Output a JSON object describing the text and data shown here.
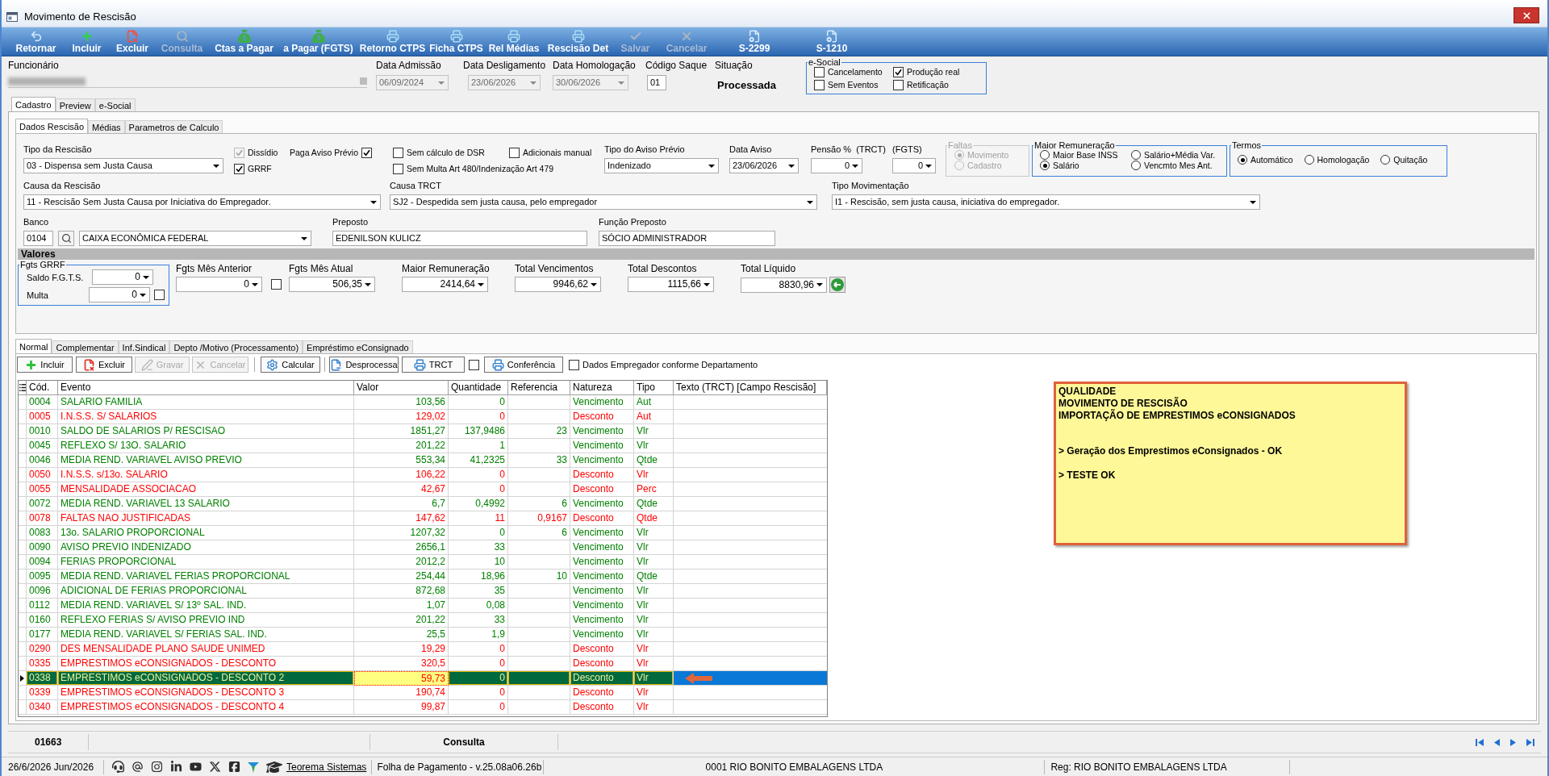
{
  "window": {
    "title": "Movimento de Rescisão"
  },
  "toolbar": [
    {
      "label": "Retornar",
      "disabled": false
    },
    {
      "label": "Incluir",
      "disabled": false
    },
    {
      "label": "Excluir",
      "disabled": false
    },
    {
      "label": "Consulta",
      "disabled": true
    },
    {
      "label": "Ctas a Pagar",
      "disabled": false
    },
    {
      "label": "a Pagar (FGTS)",
      "disabled": false
    },
    {
      "label": "Retorno CTPS",
      "disabled": false
    },
    {
      "label": "Ficha CTPS",
      "disabled": false
    },
    {
      "label": "Rel Médias",
      "disabled": false
    },
    {
      "label": "Rescisão Det",
      "disabled": false
    },
    {
      "label": "Salvar",
      "disabled": true
    },
    {
      "label": "Cancelar",
      "disabled": true
    },
    {
      "label": "S-2299",
      "disabled": false
    },
    {
      "label": "S-1210",
      "disabled": false
    }
  ],
  "header": {
    "employee": {
      "label": "Funcionário"
    },
    "dates": [
      {
        "label": "Data Admissão",
        "value": "06/09/2024",
        "disabled": true
      },
      {
        "label": "Data Desligamento",
        "value": "23/06/2026",
        "disabled": true
      },
      {
        "label": "Data Homologação",
        "value": "30/06/2026",
        "disabled": true
      }
    ],
    "codigo_saque": {
      "label": "Código Saque",
      "value": "01"
    },
    "situacao": {
      "label": "Situação",
      "value": "Processada"
    },
    "esocial": {
      "title": "e-Social",
      "options": [
        {
          "label": "Cancelamento",
          "checked": false
        },
        {
          "label": "Produção real",
          "checked": true
        },
        {
          "label": "Sem Eventos",
          "checked": false
        },
        {
          "label": "Retificação",
          "checked": false
        }
      ]
    }
  },
  "main_tabs": [
    {
      "label": "Cadastro",
      "selected": true
    },
    {
      "label": "Preview",
      "selected": false
    },
    {
      "label": "e-Social",
      "selected": false
    }
  ],
  "sub_tabs": [
    {
      "label": "Dados Rescisão",
      "selected": true
    },
    {
      "label": "Médias",
      "selected": false
    },
    {
      "label": "Parametros de Calculo",
      "selected": false
    }
  ],
  "dados_rescisao": {
    "tipo_rescisao": {
      "label": "Tipo da Rescisão",
      "value": "03 - Dispensa sem Justa Causa"
    },
    "dissidio": {
      "label": "Dissídio",
      "checked": true,
      "disabled": true
    },
    "grrf": {
      "label": "GRRF",
      "checked": true,
      "disabled": false
    },
    "paga_aviso_previo": {
      "label": "Paga Aviso Prévio",
      "checked": true
    },
    "sem_calculo_dsr": {
      "label": "Sem cálculo de DSR",
      "checked": false
    },
    "adicionais_manual": {
      "label": "Adicionais manual",
      "checked": false
    },
    "sem_multa": {
      "label": "Sem Multa Art 480/Indenização Art 479",
      "checked": false
    },
    "tipo_aviso_previo": {
      "label": "Tipo do Aviso Prévio",
      "value": "Indenizado"
    },
    "data_aviso": {
      "label": "Data Aviso",
      "value": "23/06/2026"
    },
    "pensao_trct": {
      "label": "Pensão %  (TRCT)",
      "value": "0"
    },
    "pensao_fgts": {
      "label": "(FGTS)",
      "value": "0"
    },
    "faltas": {
      "title": "Faltas",
      "disabled": true,
      "options": [
        {
          "label": "Movimento",
          "selected": true
        },
        {
          "label": "Cadastro",
          "selected": false
        }
      ]
    },
    "maior_remuneracao": {
      "title": "Maior Remuneração",
      "options": [
        {
          "label": "Maior Base INSS",
          "selected": false
        },
        {
          "label": "Salário+Média Var.",
          "selected": false
        },
        {
          "label": "Salário",
          "selected": true
        },
        {
          "label": "Vencmto Mes Ant.",
          "selected": false
        }
      ]
    },
    "termos": {
      "title": "Termos",
      "options": [
        {
          "label": "Automático",
          "selected": true
        },
        {
          "label": "Homologação",
          "selected": false
        },
        {
          "label": "Quitação",
          "selected": false
        }
      ]
    },
    "causa_rescisao": {
      "label": "Causa da Rescisão",
      "value": "11 - Rescisão Sem Justa Causa por Iniciativa do Empregador."
    },
    "causa_trct": {
      "label": "Causa TRCT",
      "value": "SJ2 - Despedida sem justa causa, pelo empregador"
    },
    "tipo_movimentacao": {
      "label": "Tipo Movimentação",
      "value": "I1 - Rescisão, sem justa causa, iniciativa do empregador."
    },
    "banco": {
      "label": "Banco",
      "code": "0104",
      "name": "CAIXA ECONÔMICA FEDERAL"
    },
    "preposto": {
      "label": "Preposto",
      "value": "EDENILSON KULICZ"
    },
    "funcao_preposto": {
      "label": "Função Preposto",
      "value": "SÓCIO ADMINISTRADOR"
    },
    "valores": {
      "title": "Valores",
      "fgts_grrf": {
        "title": "Fgts GRRF",
        "saldo": {
          "label": "Saldo F.G.T.S.",
          "value": "0"
        },
        "multa": {
          "label": "Multa",
          "value": "0",
          "checked": false
        }
      },
      "fgts_mes_anterior": {
        "label": "Fgts Mês Anterior",
        "value": "0",
        "checked": false
      },
      "totals": [
        {
          "label": "Fgts Mês Atual",
          "value": "506,35"
        },
        {
          "label": "Maior Remuneração",
          "value": "2414,64"
        },
        {
          "label": "Total Vencimentos",
          "value": "9946,62"
        },
        {
          "label": "Total Descontos",
          "value": "1115,66"
        },
        {
          "label": "Total Líquido",
          "value": "8830,96"
        }
      ]
    }
  },
  "lower_tabs": [
    {
      "label": "Normal",
      "selected": true
    },
    {
      "label": "Complementar",
      "selected": false
    },
    {
      "label": "Inf.Sindical",
      "selected": false
    },
    {
      "label": "Depto /Motivo (Processamento)",
      "selected": false
    },
    {
      "label": "Empréstimo eConsignado",
      "selected": false
    }
  ],
  "grid_toolbar": [
    {
      "kind": "button",
      "label": "Incluir",
      "disabled": false
    },
    {
      "kind": "button",
      "label": "Excluir",
      "disabled": false
    },
    {
      "kind": "button",
      "label": "Gravar",
      "disabled": true
    },
    {
      "kind": "button",
      "label": "Cancelar",
      "disabled": true
    },
    {
      "kind": "button",
      "label": "Calcular",
      "disabled": false
    },
    {
      "kind": "button",
      "label": "Desprocessa",
      "disabled": false
    },
    {
      "kind": "button",
      "label": "TRCT",
      "disabled": false
    },
    {
      "kind": "checkbox",
      "checked": false
    },
    {
      "kind": "button",
      "label": "Conferência",
      "disabled": false
    },
    {
      "kind": "checkbox",
      "label": "Dados Empregador conforme Departamento",
      "checked": false
    }
  ],
  "table": {
    "columns": [
      "Cód.",
      "Evento",
      "Valor",
      "Quantidade",
      "Referencia",
      "Natureza",
      "Tipo",
      "Texto (TRCT) [Campo Rescisão]"
    ],
    "rows": [
      {
        "cod": "0004",
        "evento": "SALARIO FAMILIA",
        "valor": "103,56",
        "quantidade": "0",
        "natureza": "Vencimento",
        "tipo": "Aut",
        "color": "#008000",
        "selected": false
      },
      {
        "cod": "0005",
        "evento": "I.N.S.S. S/ SALARIOS",
        "valor": "129,02",
        "quantidade": "0",
        "natureza": "Desconto",
        "tipo": "Aut",
        "color": "#ff0000",
        "selected": false
      },
      {
        "cod": "0010",
        "evento": "SALDO DE SALARIOS P/ RESCISAO",
        "valor": "1851,27",
        "quantidade": "137,9486",
        "referencia": "23",
        "natureza": "Vencimento",
        "tipo": "Vlr",
        "color": "#008000",
        "selected": false
      },
      {
        "cod": "0045",
        "evento": "REFLEXO S/ 13O. SALARIO",
        "valor": "201,22",
        "quantidade": "1",
        "natureza": "Vencimento",
        "tipo": "Vlr",
        "color": "#008000",
        "selected": false
      },
      {
        "cod": "0046",
        "evento": "MEDIA REND. VARIAVEL AVISO PREVIO",
        "valor": "553,34",
        "quantidade": "41,2325",
        "referencia": "33",
        "natureza": "Vencimento",
        "tipo": "Qtde",
        "color": "#008000",
        "selected": false
      },
      {
        "cod": "0050",
        "evento": "I.N.S.S. s/13o. SALARIO",
        "valor": "106,22",
        "quantidade": "0",
        "natureza": "Desconto",
        "tipo": "Vlr",
        "color": "#ff0000",
        "selected": false
      },
      {
        "cod": "0055",
        "evento": "MENSALIDADE ASSOCIACAO",
        "valor": "42,67",
        "quantidade": "0",
        "natureza": "Desconto",
        "tipo": "Perc",
        "color": "#ff0000",
        "selected": false
      },
      {
        "cod": "0072",
        "evento": "MEDIA REND. VARIAVEL 13 SALARIO",
        "valor": "6,7",
        "quantidade": "0,4992",
        "referencia": "6",
        "natureza": "Vencimento",
        "tipo": "Qtde",
        "color": "#008000",
        "selected": false
      },
      {
        "cod": "0078",
        "evento": "FALTAS NAO JUSTIFICADAS",
        "valor": "147,62",
        "quantidade": "11",
        "referencia": "0,9167",
        "natureza": "Desconto",
        "tipo": "Qtde",
        "color": "#ff0000",
        "selected": false
      },
      {
        "cod": "0083",
        "evento": "13o. SALARIO PROPORCIONAL",
        "valor": "1207,32",
        "quantidade": "0",
        "referencia": "6",
        "natureza": "Vencimento",
        "tipo": "Vlr",
        "color": "#008000",
        "selected": false
      },
      {
        "cod": "0090",
        "evento": "AVISO PREVIO INDENIZADO",
        "valor": "2656,1",
        "quantidade": "33",
        "natureza": "Vencimento",
        "tipo": "Vlr",
        "color": "#008000",
        "selected": false
      },
      {
        "cod": "0094",
        "evento": "FERIAS PROPORCIONAL",
        "valor": "2012,2",
        "quantidade": "10",
        "natureza": "Vencimento",
        "tipo": "Vlr",
        "color": "#008000",
        "selected": false
      },
      {
        "cod": "0095",
        "evento": "MEDIA REND. VARIAVEL FERIAS PROPORCIONAL",
        "valor": "254,44",
        "quantidade": "18,96",
        "referencia": "10",
        "natureza": "Vencimento",
        "tipo": "Qtde",
        "color": "#008000",
        "selected": false
      },
      {
        "cod": "0096",
        "evento": "ADICIONAL DE FERIAS PROPORCIONAL",
        "valor": "872,68",
        "quantidade": "35",
        "natureza": "Vencimento",
        "tipo": "Vlr",
        "color": "#008000",
        "selected": false
      },
      {
        "cod": "0112",
        "evento": "MEDIA REND. VARIAVEL S/ 13º SAL. IND.",
        "valor": "1,07",
        "quantidade": "0,08",
        "natureza": "Vencimento",
        "tipo": "Vlr",
        "color": "#008000",
        "selected": false
      },
      {
        "cod": "0160",
        "evento": "REFLEXO FERIAS S/ AVISO PREVIO IND",
        "valor": "201,22",
        "quantidade": "33",
        "natureza": "Vencimento",
        "tipo": "Vlr",
        "color": "#008000",
        "selected": false
      },
      {
        "cod": "0177",
        "evento": "MEDIA REND. VARIAVEL S/ FERIAS SAL. IND.",
        "valor": "25,5",
        "quantidade": "1,9",
        "natureza": "Vencimento",
        "tipo": "Vlr",
        "color": "#008000",
        "selected": false
      },
      {
        "cod": "0290",
        "evento": "DES MENSALIDADE PLANO SAUDE UNIMED",
        "valor": "19,29",
        "quantidade": "0",
        "natureza": "Desconto",
        "tipo": "Vlr",
        "color": "#ff0000",
        "selected": false
      },
      {
        "cod": "0335",
        "evento": "EMPRESTIMOS eCONSIGNADOS - DESCONTO",
        "valor": "320,5",
        "quantidade": "0",
        "natureza": "Desconto",
        "tipo": "Vlr",
        "color": "#ff0000",
        "selected": false
      },
      {
        "cod": "0338",
        "evento": "EMPRESTIMOS eCONSIGNADOS - DESCONTO 2",
        "valor": "59,73",
        "quantidade": "0",
        "natureza": "Desconto",
        "tipo": "Vlr",
        "color": "#ff0000",
        "selected": true
      },
      {
        "cod": "0339",
        "evento": "EMPRESTIMOS eCONSIGNADOS - DESCONTO 3",
        "valor": "190,74",
        "quantidade": "0",
        "natureza": "Desconto",
        "tipo": "Vlr",
        "color": "#ff0000",
        "selected": false
      },
      {
        "cod": "0340",
        "evento": "EMPRESTIMOS eCONSIGNADOS - DESCONTO 4",
        "valor": "99,87",
        "quantidade": "0",
        "natureza": "Desconto",
        "tipo": "Vlr",
        "color": "#ff0000",
        "selected": false
      }
    ]
  },
  "note": {
    "lines": [
      "QUALIDADE",
      "MOVIMENTO DE RESCISÃO",
      "IMPORTAÇÃO DE EMPRESTIMOS eCONSIGNADOS",
      "> Geração dos Emprestimos eConsignados - OK",
      "> TESTE OK"
    ]
  },
  "record_bar": {
    "code": "01663",
    "mode": "Consulta"
  },
  "status_bar": {
    "date": "26/6/2026 Jun/2026",
    "link": "Teorema Sistemas",
    "version": "Folha de Pagamento - v.25.08a06.26b",
    "company": "0001 RIO BONITO EMBALAGENS LTDA",
    "registry": "Reg: RIO BONITO EMBALAGENS LTDA"
  }
}
